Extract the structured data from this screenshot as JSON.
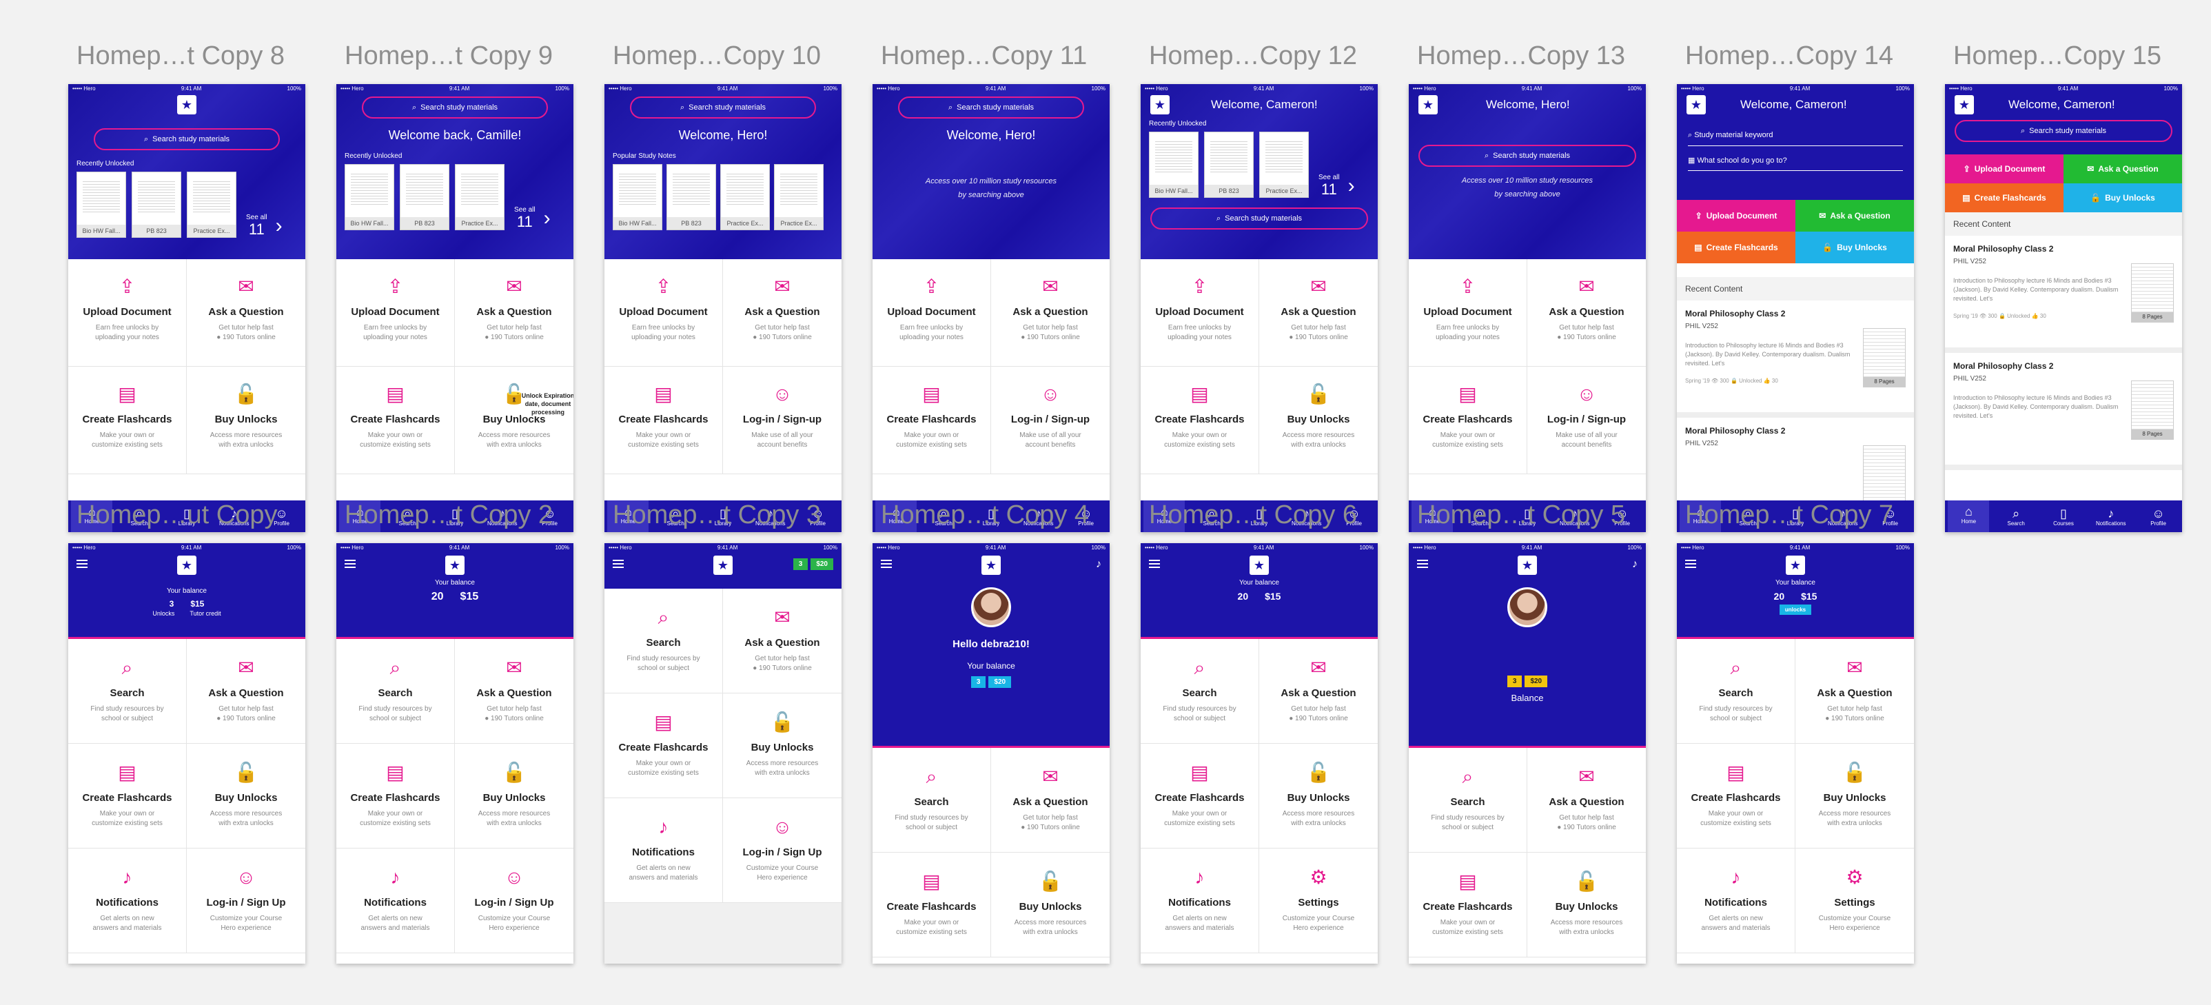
{
  "artboards": {
    "a1": {
      "title": "Homep…t Copy 8"
    },
    "a2": {
      "title": "Homep…t Copy 9"
    },
    "a3": {
      "title": "Homep…Copy 10"
    },
    "a4": {
      "title": "Homep…Copy 11"
    },
    "a5": {
      "title": "Homep…Copy 12"
    },
    "a6": {
      "title": "Homep…Copy 13"
    },
    "a7": {
      "title": "Homep…Copy 14"
    },
    "a8": {
      "title": "Homep…Copy 15"
    },
    "b1": {
      "title": "Homep…ut Copy"
    },
    "b2": {
      "title": "Homep…t Copy 2"
    },
    "b3": {
      "title": "Homep…t Copy 3"
    },
    "b4": {
      "title": "Homep…t Copy 4"
    },
    "b5": {
      "title": "Homep…t Copy 6"
    },
    "b6": {
      "title": "Homep…t Copy 5"
    },
    "b7": {
      "title": "Homep…t Copy 7"
    }
  },
  "status": {
    "carrier": "••••• Hero",
    "time": "9:41 AM",
    "battery": "100%"
  },
  "search_placeholder": "Search study materials",
  "welcome_back": "Welcome back, Camille!",
  "welcome_hero": "Welcome, Hero!",
  "welcome_cameron": "Welcome, Cameron!",
  "access_line1": "Access over 10 million study resources",
  "access_line2": "by searching above",
  "recently_unlocked": "Recently Unlocked",
  "popular_notes": "Popular Study Notes",
  "docs": [
    "Bio HW Fall...",
    "PB 823",
    "Practice Ex...",
    "Practice Ex..."
  ],
  "see_all": "See all",
  "see_all_count": "11",
  "tiles": {
    "upload": {
      "title": "Upload Document",
      "desc1": "Earn free unlocks by",
      "desc2": "uploading your notes"
    },
    "ask": {
      "title": "Ask a Question",
      "desc1": "Get tutor help fast",
      "desc2": "● 190 Tutors online"
    },
    "flash": {
      "title": "Create Flashcards",
      "desc1": "Make your own or",
      "desc2": "customize existing sets"
    },
    "buy": {
      "title": "Buy Unlocks",
      "desc1": "Access more resources",
      "desc2": "with extra unlocks"
    },
    "login": {
      "title": "Log-in / Sign-up",
      "desc1": "Make use of all your",
      "desc2": "account benefits"
    },
    "login2": {
      "title": "Log-in / Sign Up",
      "desc1": "Customize your Course",
      "desc2": "Hero experience"
    },
    "search": {
      "title": "Search",
      "desc1": "Find study resources by",
      "desc2": "school or subject"
    },
    "notif": {
      "title": "Notifications",
      "desc1": "Get alerts on new",
      "desc2": "answers and materials"
    },
    "settings": {
      "title": "Settings",
      "desc1": "Customize your Course",
      "desc2": "Hero experience"
    }
  },
  "tabs": [
    "Home",
    "Search",
    "Library",
    "Notifications",
    "Profile"
  ],
  "tabs_alt": [
    "Home",
    "Search",
    "Courses",
    "Notifications",
    "Profile"
  ],
  "tooltip_text": "Unlock Expiration date, document processing",
  "balance": {
    "label": "Your balance",
    "unlocks": "3",
    "unlocks_label": "Unlocks",
    "credit": "$15",
    "credit_label": "Tutor credit",
    "unlocks2": "20",
    "credit2": "$15",
    "chip_unlocks": "3",
    "chip_credit": "$20",
    "balance_word": "Balance",
    "unlocks_tag": "unlocks"
  },
  "hello": "Hello debra210!",
  "quick": {
    "upload": "Upload Document",
    "ask": "Ask a Question",
    "flash": "Create Flashcards",
    "buy": "Buy Unlocks"
  },
  "keyword_placeholder": "Study material keyword",
  "school_placeholder": "What school do you go to?",
  "recent_content": "Recent Content",
  "card": {
    "title": "Moral Philosophy Class 2",
    "course": "PHIL V252",
    "body": "Introduction to Philosophy lecture I6 Minds and Bodies #3 (Jackson). By David Kelley. Contemporary dualism. Dualism revisited. Let's",
    "pages": "8 Pages",
    "meta": "Spring '19   👁 300   🔒 Unlocked   👍 30"
  }
}
